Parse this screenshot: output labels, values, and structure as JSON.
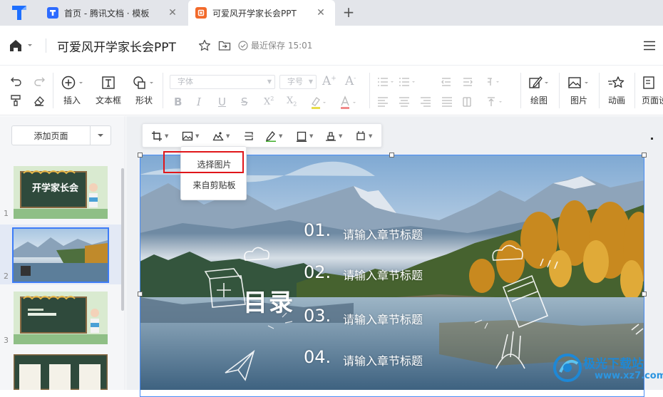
{
  "tabs": {
    "items": [
      {
        "label": "首页 - 腾讯文档 · 模板",
        "icon": "tencent-docs-icon"
      },
      {
        "label": "可爱风开学家长会PPT",
        "icon": "ppt-icon"
      }
    ],
    "active_index": 1
  },
  "titlebar": {
    "doc_title": "可爱风开学家长会PPT",
    "save_status": "最近保存 15:01"
  },
  "toolbar": {
    "insert_label": "插入",
    "textbox_label": "文本框",
    "shape_label": "形状",
    "font_placeholder": "字体",
    "size_placeholder": "字号",
    "draw_label": "绘图",
    "picture_label": "图片",
    "animation_label": "动画",
    "page_label": "页面设"
  },
  "sidebar": {
    "add_page_label": "添加页面",
    "slides": [
      {
        "number": "1",
        "title": "开学家长会"
      },
      {
        "number": "2",
        "title": ""
      },
      {
        "number": "3",
        "title": ""
      },
      {
        "number": "",
        "title": ""
      }
    ],
    "selected_index": 1
  },
  "image_menu": {
    "items": [
      "选择图片",
      "来自剪贴板"
    ],
    "highlighted_index": 0
  },
  "slide": {
    "heading": "目录",
    "chapters": [
      {
        "num": "01.",
        "title": "请输入章节标题"
      },
      {
        "num": "02.",
        "title": "请输入章节标题"
      },
      {
        "num": "03.",
        "title": "请输入章节标题"
      },
      {
        "num": "04.",
        "title": "请输入章节标题"
      }
    ]
  },
  "watermark": {
    "text": "极光下载站",
    "url": "www.xz7.com"
  },
  "colors": {
    "accent": "#3d7cf7",
    "highlight_box": "#e0161a",
    "tab_bar": "#e3e5ea"
  }
}
